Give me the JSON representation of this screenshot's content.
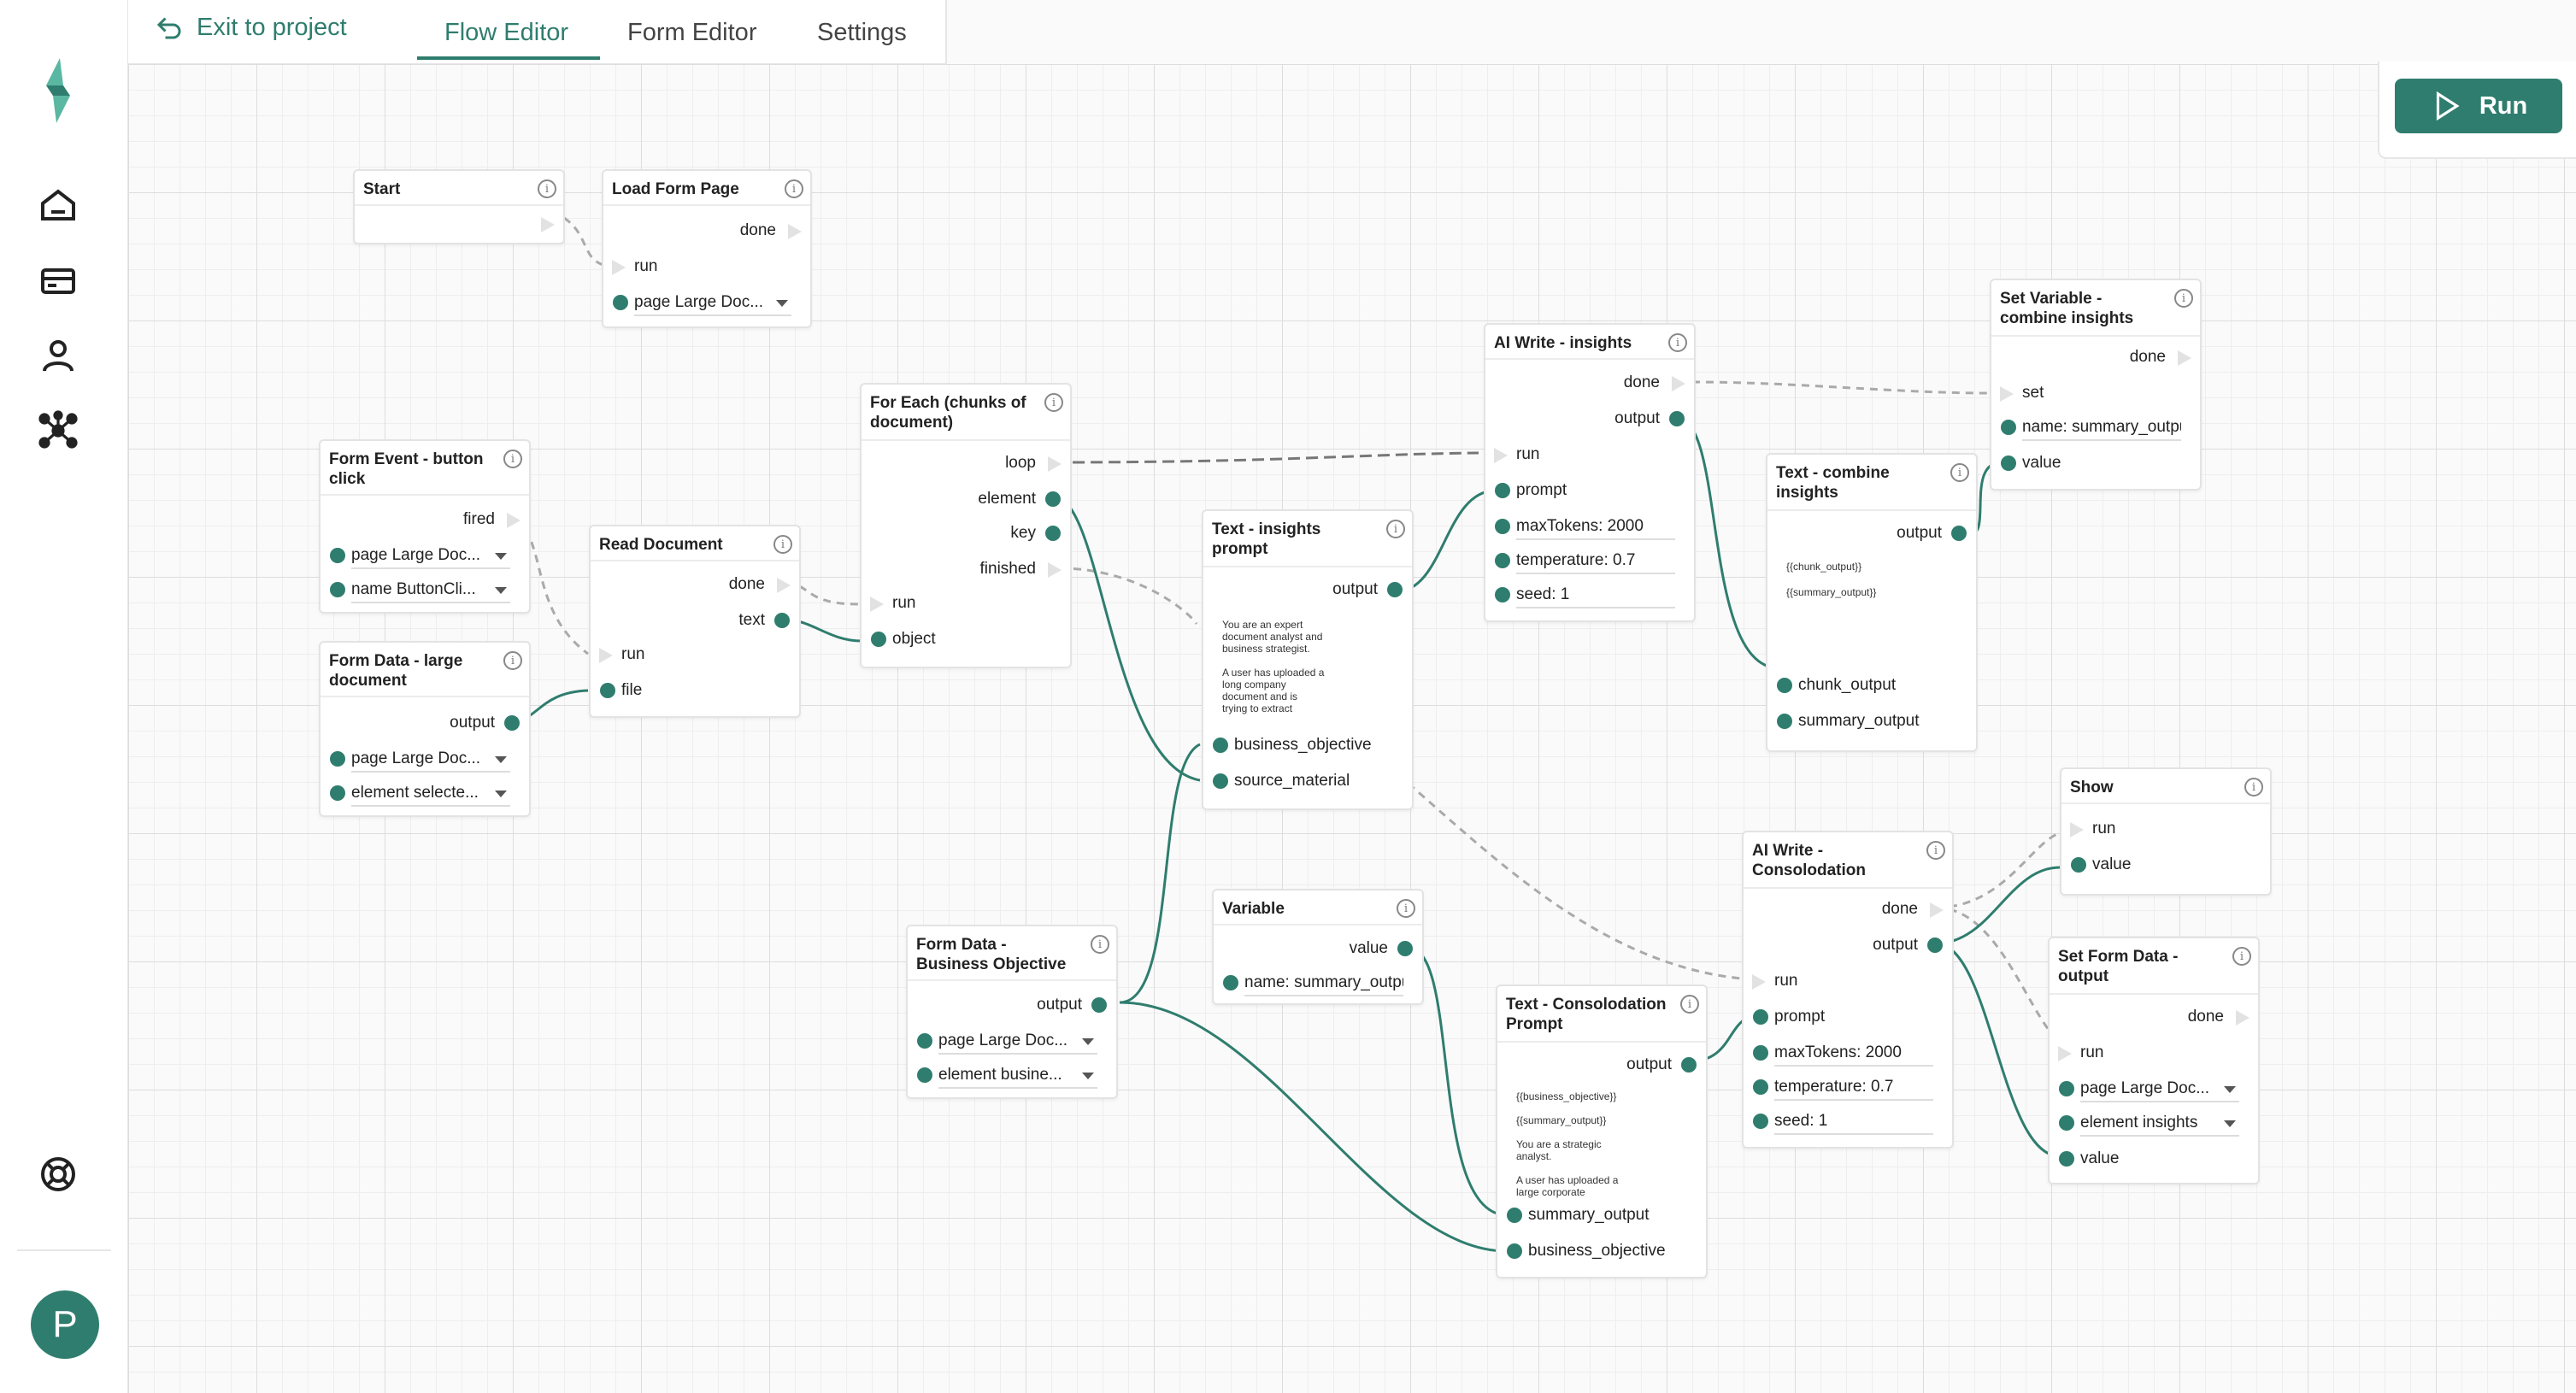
{
  "header": {
    "exit_label": "Exit to project",
    "tabs": [
      "Flow Editor",
      "Form Editor",
      "Settings"
    ],
    "active_tab": "Flow Editor",
    "run_label": "Run"
  },
  "sidebar": {
    "icons": [
      "logo-icon",
      "home-icon",
      "card-icon",
      "user-icon",
      "nodes-icon",
      "help-icon"
    ],
    "avatar_initial": "P"
  },
  "colors": {
    "accent": "#2f7d6e",
    "wire": "#2f7d6e",
    "exec_wire": "#aaaaaa"
  },
  "nodes": {
    "start": {
      "title": "Start"
    },
    "load_form_page": {
      "title": "Load Form Page",
      "out_done": "done",
      "in_run": "run",
      "page_name": "page",
      "page_value": "Large Doc..."
    },
    "form_event": {
      "title": "Form Event - button click",
      "out_fired": "fired",
      "page_name": "page",
      "page_value": "Large Doc...",
      "name_name": "name",
      "name_value": "ButtonCli..."
    },
    "form_data_large": {
      "title": "Form Data - large document",
      "out_output": "output",
      "page_name": "page",
      "page_value": "Large Doc...",
      "element_name": "element",
      "element_value": "selecte..."
    },
    "read_document": {
      "title": "Read Document",
      "out_done": "done",
      "out_text": "text",
      "in_run": "run",
      "in_file": "file"
    },
    "for_each": {
      "title": "For Each (chunks of document)",
      "out_loop": "loop",
      "out_element": "element",
      "out_key": "key",
      "out_finished": "finished",
      "in_run": "run",
      "in_object": "object"
    },
    "text_insights": {
      "title": "Text - insights prompt",
      "out_output": "output",
      "body": "You are an expert\ndocument analyst and\nbusiness strategist.\n\nA user has uploaded a\nlong company\ndocument and is\ntrying to extract",
      "in_business": "business_objective",
      "in_source": "source_material"
    },
    "ai_write_insights": {
      "title": "AI Write - insights",
      "out_done": "done",
      "out_output": "output",
      "in_run": "run",
      "in_prompt": "prompt",
      "max_name": "maxTokens:",
      "max_value": "2000",
      "temp_name": "temperature:",
      "temp_value": "0.7",
      "seed_name": "seed:",
      "seed_value": "1"
    },
    "text_combine": {
      "title": "Text - combine insights",
      "out_output": "output",
      "line1": "{{chunk_output}}",
      "line2": "{{summary_output}}",
      "in_chunk": "chunk_output",
      "in_summary": "summary_output"
    },
    "set_variable": {
      "title": "Set Variable - combine insights",
      "out_done": "done",
      "in_set": "set",
      "name_name": "name:",
      "name_value": "summary_outpu",
      "in_value": "value"
    },
    "variable": {
      "title": "Variable",
      "out_value": "value",
      "name_name": "name:",
      "name_value": "summary_outpu"
    },
    "form_data_business": {
      "title": "Form Data - Business Objective",
      "out_output": "output",
      "page_name": "page",
      "page_value": "Large Doc...",
      "element_name": "element",
      "element_value": "busine..."
    },
    "text_consolidation": {
      "title": "Text - Consolodation Prompt",
      "out_output": "output",
      "body": "{{business_objective}}\n\n{{summary_output}}\n\nYou are a strategic\nanalyst.\n\nA user has uploaded a\nlarge corporate",
      "in_summary": "summary_output",
      "in_business": "business_objective"
    },
    "ai_write_consolidation": {
      "title": "AI Write - Consolodation",
      "out_done": "done",
      "out_output": "output",
      "in_run": "run",
      "in_prompt": "prompt",
      "max_name": "maxTokens:",
      "max_value": "2000",
      "temp_name": "temperature:",
      "temp_value": "0.7",
      "seed_name": "seed:",
      "seed_value": "1"
    },
    "show": {
      "title": "Show",
      "in_run": "run",
      "in_value": "value"
    },
    "set_form_data": {
      "title": "Set Form Data - output",
      "out_done": "done",
      "in_run": "run",
      "page_name": "page",
      "page_value": "Large Doc...",
      "element_name": "element",
      "element_value": "insights",
      "in_value": "value"
    }
  }
}
